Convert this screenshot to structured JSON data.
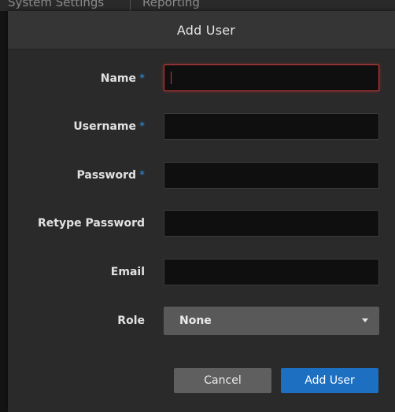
{
  "background": {
    "tab_system_settings": "System Settings",
    "tab_reporting": "Reporting"
  },
  "dialog": {
    "title": "Add User",
    "required_marker": "*",
    "fields": {
      "name": {
        "label": "Name",
        "value": "",
        "required": true
      },
      "username": {
        "label": "Username",
        "value": "",
        "required": true
      },
      "password": {
        "label": "Password",
        "value": "",
        "required": true
      },
      "retype_password": {
        "label": "Retype Password",
        "value": "",
        "required": false
      },
      "email": {
        "label": "Email",
        "value": "",
        "required": false
      },
      "role": {
        "label": "Role",
        "selected": "None"
      }
    },
    "buttons": {
      "cancel": "Cancel",
      "add_user": "Add User"
    }
  },
  "colors": {
    "required": "#2f8fe0",
    "focus": "#c53a3a",
    "primary_button": "#1c6fc1"
  }
}
